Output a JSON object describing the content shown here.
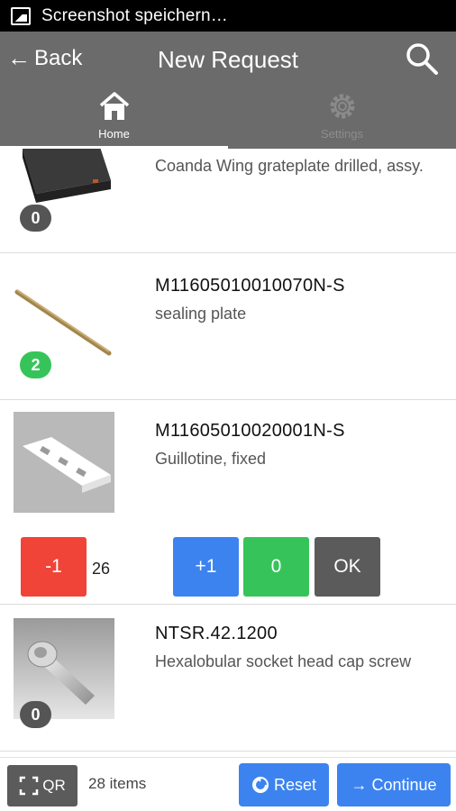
{
  "statusbar": {
    "icon": "image-icon",
    "text": "Screenshot speichern…"
  },
  "header": {
    "back_label": "Back",
    "back_arrow": "←",
    "title": "New Request",
    "search_icon": "search-icon"
  },
  "tabs": [
    {
      "label": "Home",
      "icon": "home-icon",
      "active": true
    },
    {
      "label": "Settings",
      "icon": "gear-icon",
      "active": false
    }
  ],
  "items": [
    {
      "code": "",
      "desc": "Coanda Wing grateplate drilled, assy.",
      "badge": "0",
      "badge_color": "#555555"
    },
    {
      "code": "M11605010010070N-S",
      "desc": "sealing plate",
      "badge": "2",
      "badge_color": "#36c45a"
    },
    {
      "code": "M11605010020001N-S",
      "desc": "Guillotine, fixed",
      "badge": "",
      "badge_color": ""
    },
    {
      "code": "NTSR.42.1200",
      "desc": "Hexalobular socket head cap screw",
      "badge": "0",
      "badge_color": "#555555"
    }
  ],
  "quantity": {
    "minus_label": "-1",
    "value": "26",
    "plus_label": "+1",
    "zero_label": "0",
    "ok_label": "OK"
  },
  "bottombar": {
    "qr_label": "QR",
    "count_text": "28 items",
    "reset_label": "Reset",
    "continue_label": "Continue",
    "continue_arrow": "→"
  },
  "colors": {
    "header": "#6b6b6b",
    "accent_blue": "#3c83f0",
    "red": "#f04438",
    "green": "#36c45a",
    "dark": "#5b5b5b"
  }
}
